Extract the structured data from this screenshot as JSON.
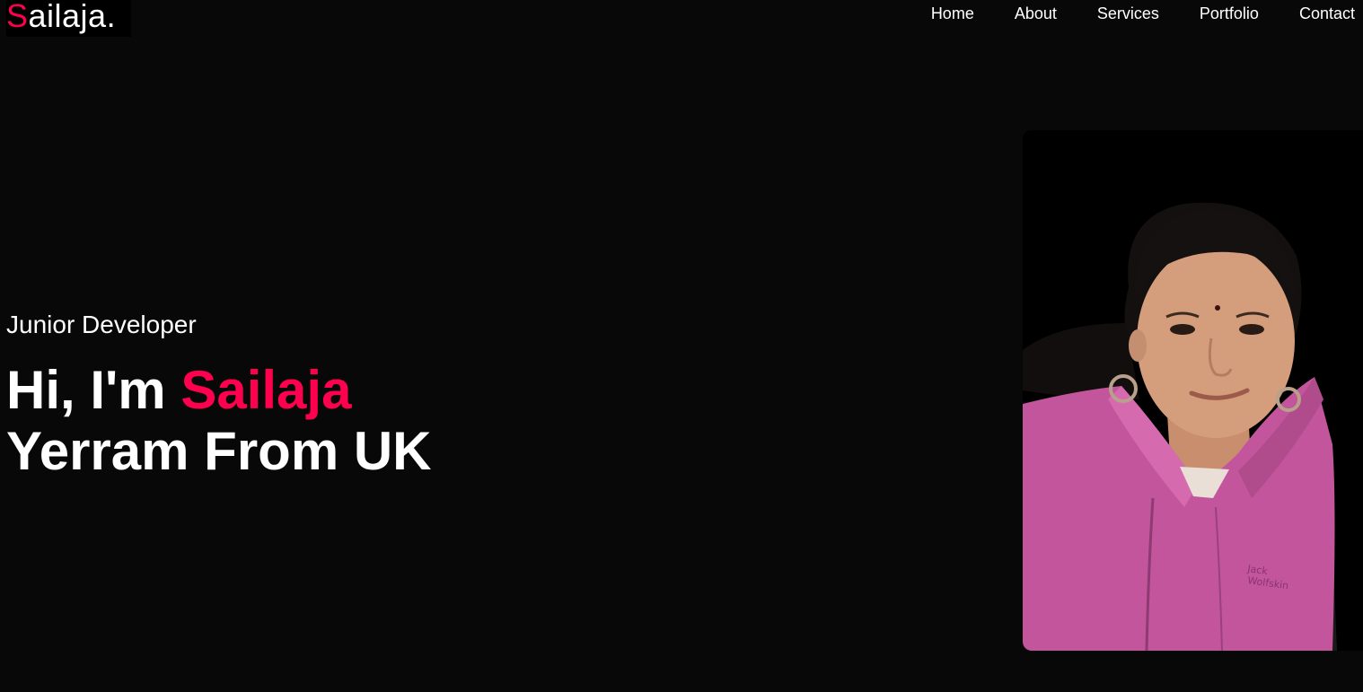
{
  "header": {
    "logo_first_letter": "S",
    "logo_rest": "ailaja.",
    "nav": [
      {
        "label": "Home"
      },
      {
        "label": "About"
      },
      {
        "label": "Services"
      },
      {
        "label": "Portfolio"
      },
      {
        "label": "Contact"
      }
    ]
  },
  "hero": {
    "role": "Junior Developer",
    "greeting": "Hi, I'm",
    "name_highlight": "Sailaja",
    "line2": "Yerram From UK"
  },
  "colors": {
    "background": "#080808",
    "accent": "#ff004f",
    "text": "#ffffff"
  }
}
